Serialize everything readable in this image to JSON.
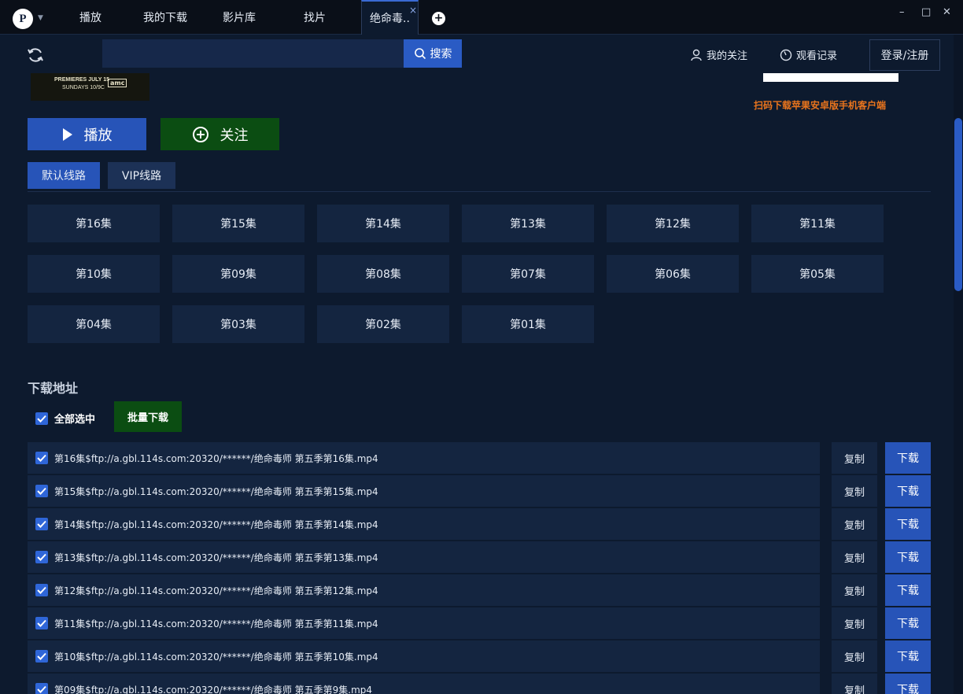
{
  "titlebar": {
    "logo_letter": "P",
    "tabs": [
      {
        "label": "播放"
      },
      {
        "label": "我的下载"
      },
      {
        "label": "影片库"
      },
      {
        "label": "找片"
      },
      {
        "label": "绝命毒.."
      }
    ],
    "close_tab_glyph": "×",
    "add_tab_glyph": "+",
    "window_controls": {
      "minimize": "–",
      "maximize": "□",
      "close": "✕"
    }
  },
  "toolbar": {
    "search_placeholder": "",
    "search_label": "搜索",
    "follow_link": "我的关注",
    "history_link": "观看记录",
    "login_label": "登录/注册"
  },
  "poster": {
    "line1": "PREMIERES JULY 15",
    "line2": "SUNDAYS 10/9C",
    "brand": "amc"
  },
  "qr_caption": "扫码下载苹果安卓版手机客户端",
  "actions": {
    "play_label": "播放",
    "follow_label": "关注"
  },
  "routes": [
    {
      "label": "默认线路",
      "selected": true
    },
    {
      "label": "VIP线路",
      "selected": false
    }
  ],
  "episodes": [
    "第16集",
    "第15集",
    "第14集",
    "第13集",
    "第12集",
    "第11集",
    "第10集",
    "第09集",
    "第08集",
    "第07集",
    "第06集",
    "第05集",
    "第04集",
    "第03集",
    "第02集",
    "第01集"
  ],
  "downloads": {
    "title": "下载地址",
    "select_all_label": "全部选中",
    "batch_label": "批量下载",
    "copy_label": "复制",
    "download_label": "下载",
    "items": [
      {
        "text": "第16集$ftp://a.gbl.114s.com:20320/******/绝命毒师 第五季第16集.mp4",
        "checked": true
      },
      {
        "text": "第15集$ftp://a.gbl.114s.com:20320/******/绝命毒师 第五季第15集.mp4",
        "checked": true
      },
      {
        "text": "第14集$ftp://a.gbl.114s.com:20320/******/绝命毒师 第五季第14集.mp4",
        "checked": true
      },
      {
        "text": "第13集$ftp://a.gbl.114s.com:20320/******/绝命毒师 第五季第13集.mp4",
        "checked": true
      },
      {
        "text": "第12集$ftp://a.gbl.114s.com:20320/******/绝命毒师 第五季第12集.mp4",
        "checked": true
      },
      {
        "text": "第11集$ftp://a.gbl.114s.com:20320/******/绝命毒师 第五季第11集.mp4",
        "checked": true
      },
      {
        "text": "第10集$ftp://a.gbl.114s.com:20320/******/绝命毒师 第五季第10集.mp4",
        "checked": true
      },
      {
        "text": "第09集$ftp://a.gbl.114s.com:20320/******/绝命毒师 第五季第9集.mp4",
        "checked": true
      }
    ]
  },
  "colors": {
    "background": "#0d1a2e",
    "accent_blue": "#2754b8",
    "accent_green": "#0b4d12",
    "promo_orange": "#e8741d"
  },
  "icons": {
    "refresh": "refresh-icon",
    "search": "search-icon",
    "user": "user-icon",
    "clock": "clock-icon",
    "play": "play-icon",
    "plus_circle": "plus-circle-icon",
    "check": "check-icon"
  }
}
